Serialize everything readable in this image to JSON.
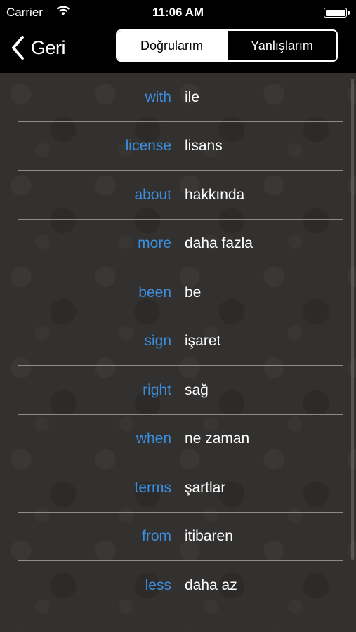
{
  "status_bar": {
    "carrier": "Carrier",
    "time": "11:06 AM",
    "battery_level": 1.0
  },
  "nav": {
    "back_label": "Geri",
    "segments": [
      {
        "label": "Doğrularım",
        "selected": true
      },
      {
        "label": "Yanlışlarım",
        "selected": false
      }
    ]
  },
  "colors": {
    "english_word": "#3c8fe0",
    "translation": "#ffffff",
    "header_bg": "#000000"
  },
  "words": [
    {
      "en": "with",
      "tr": "ile"
    },
    {
      "en": "license",
      "tr": "lisans"
    },
    {
      "en": "about",
      "tr": "hakkında"
    },
    {
      "en": "more",
      "tr": "daha fazla"
    },
    {
      "en": "been",
      "tr": "be"
    },
    {
      "en": "sign",
      "tr": "işaret"
    },
    {
      "en": "right",
      "tr": "sağ"
    },
    {
      "en": "when",
      "tr": "ne zaman"
    },
    {
      "en": "terms",
      "tr": "şartlar"
    },
    {
      "en": "from",
      "tr": "itibaren"
    },
    {
      "en": "less",
      "tr": "daha az"
    }
  ]
}
